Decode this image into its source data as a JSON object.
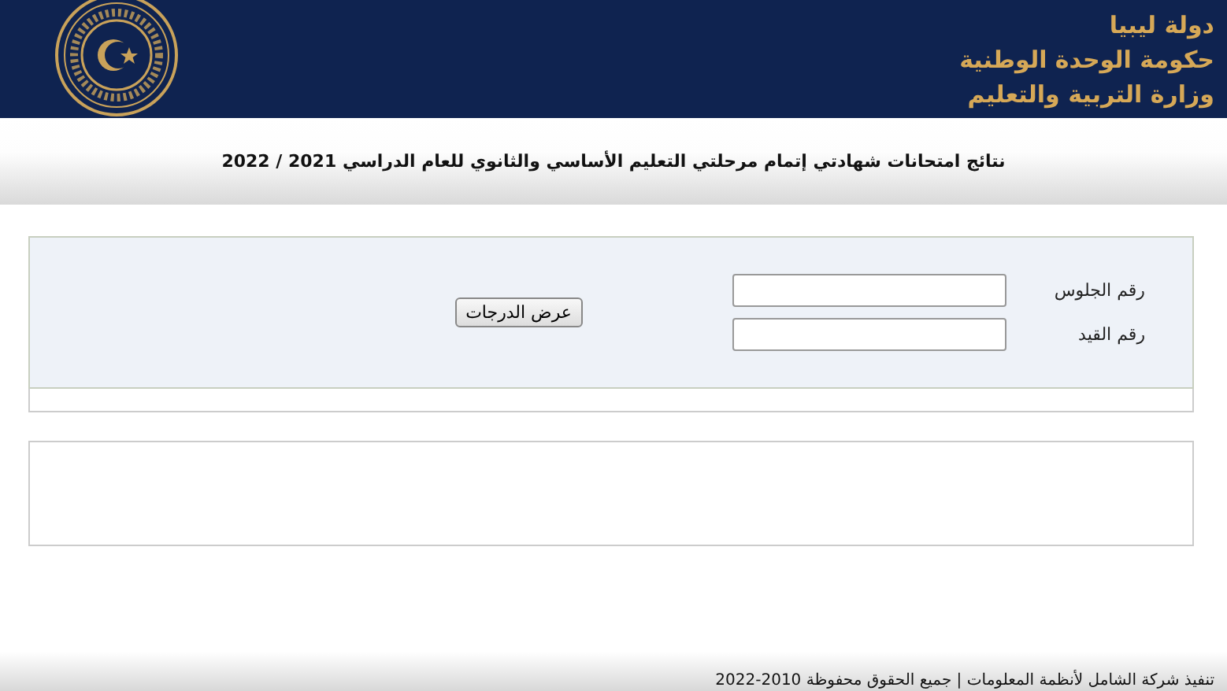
{
  "header": {
    "lines": [
      "دولة ليبيا",
      "حكومة الوحدة الوطنية",
      "وزارة التربية والتعليم"
    ]
  },
  "title": "نتائج امتحانات شهادتي إتمام مرحلتي التعليم الأساسي والثانوي للعام الدراسي 2021 / 2022",
  "form": {
    "fields": [
      {
        "label": "رقم الجلوس"
      },
      {
        "label": "رقم القيد"
      }
    ],
    "button": "عرض الدرجات"
  },
  "footer": "تنفيذ شركة الشامل لأنظمة المعلومات | جميع الحقوق محفوظة 2010-2022"
}
